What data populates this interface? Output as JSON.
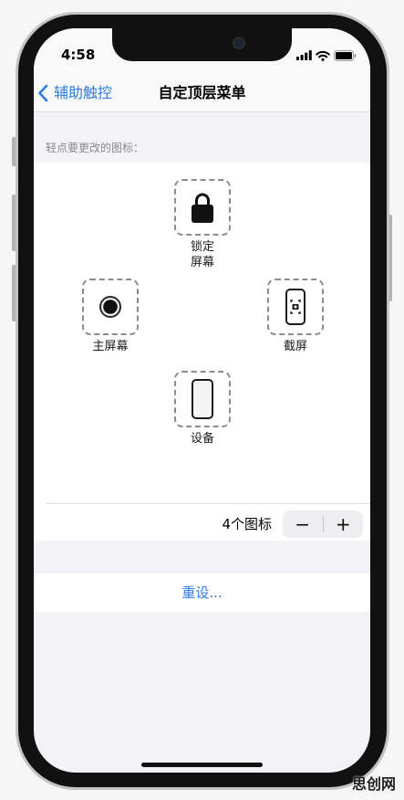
{
  "status_bar": {
    "time": "4:58",
    "signal_icon": "cellular-signal-icon",
    "wifi_icon": "wifi-icon",
    "battery_icon": "battery-icon"
  },
  "nav": {
    "back_icon": "chevron-left-icon",
    "back_label": "辅助触控",
    "title": "自定顶层菜单"
  },
  "customize": {
    "section_header": "轻点要更改的图标：",
    "icons": {
      "lock": {
        "icon": "lock-icon",
        "label_line1": "锁定",
        "label_line2": "屏幕"
      },
      "home": {
        "icon": "home-button-icon",
        "label": "主屏幕"
      },
      "screenshot": {
        "icon": "screenshot-icon",
        "label": "截屏"
      },
      "device": {
        "icon": "device-icon",
        "label": "设备"
      }
    },
    "icon_count": {
      "label": "4个图标",
      "decrement": "−",
      "increment": "+"
    }
  },
  "reset": {
    "label": "重设..."
  },
  "watermark": "思创网",
  "colors": {
    "accent": "#2f7de1",
    "grouped_background": "#f2f2f7",
    "card": "#ffffff",
    "secondary_text": "#8a8a8e"
  }
}
